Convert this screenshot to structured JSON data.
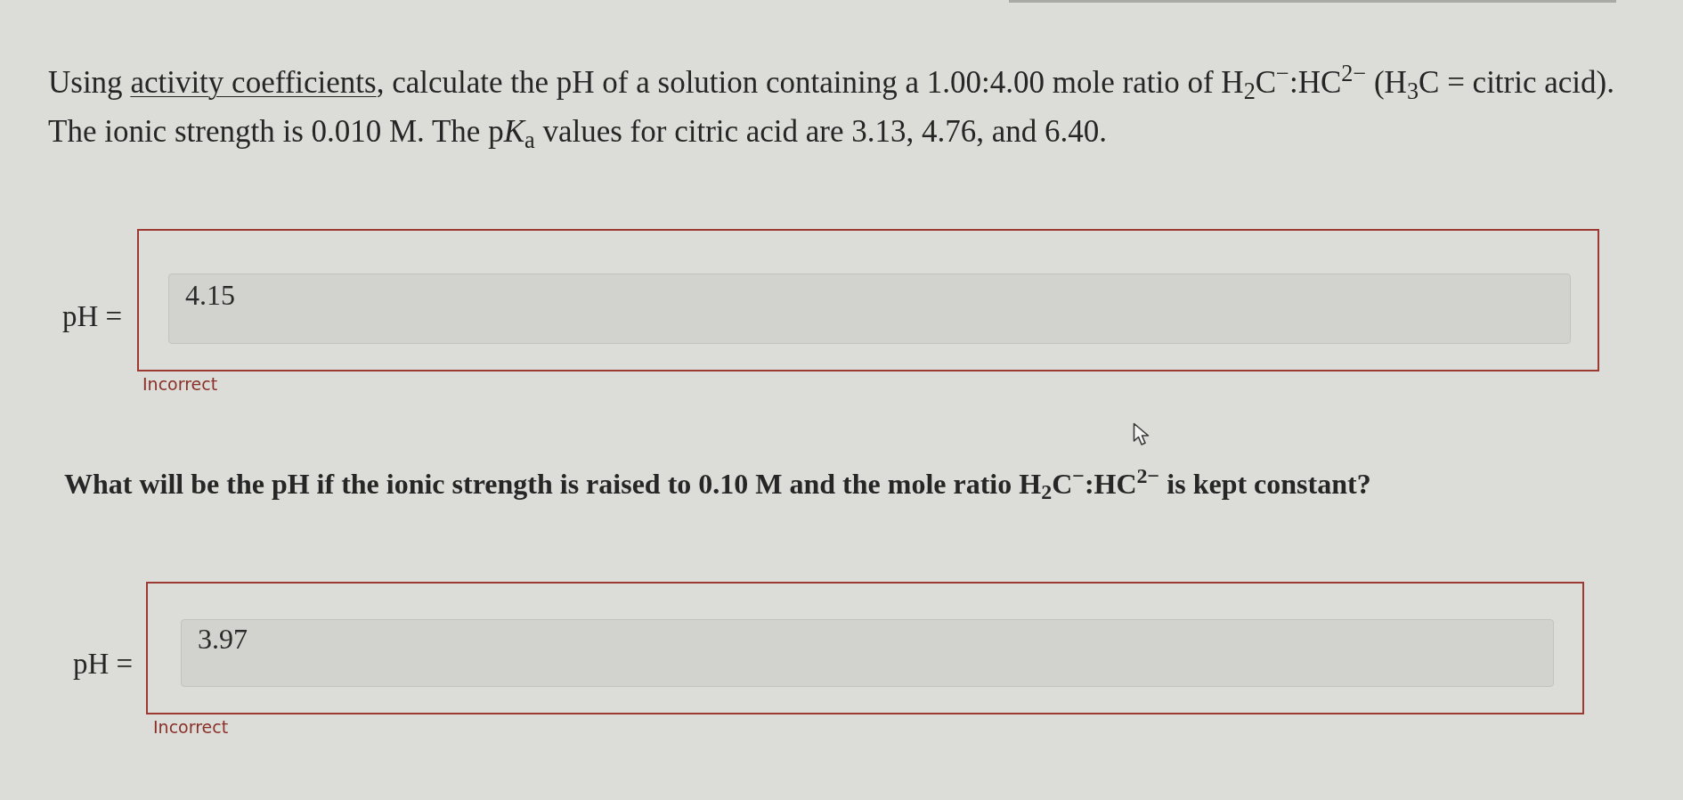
{
  "questions": [
    {
      "kind": "intro",
      "segments": [
        {
          "kind": "text",
          "text": "Using "
        },
        {
          "kind": "link",
          "text": "activity coefficients"
        },
        {
          "kind": "text",
          "text": ", calculate the pH of a solution containing a 1.00:4.00 mole ratio of H$_{2}$C$^{−}$:HC$^{2−}$ (H$_{3}$C = citric acid). The ionic strength is 0.010 M. The p"
        },
        {
          "kind": "italic",
          "text": "K"
        },
        {
          "kind": "text",
          "text": "$_{a}$ values for citric acid are 3.13, 4.76, and 6.40."
        }
      ],
      "answer": {
        "label": "pH =",
        "value": "4.15",
        "correct": false,
        "feedback": "Incorrect"
      }
    },
    {
      "kind": "follow_up",
      "segments": [
        {
          "kind": "text",
          "text": "What will be the pH if the ionic strength is raised to 0.10 M and the mole ratio H$_{2}$C$^{−}$:HC$^{2−}$ is kept constant?"
        }
      ],
      "answer": {
        "label": "pH =",
        "value": "3.97",
        "correct": false,
        "feedback": "Incorrect"
      }
    }
  ]
}
